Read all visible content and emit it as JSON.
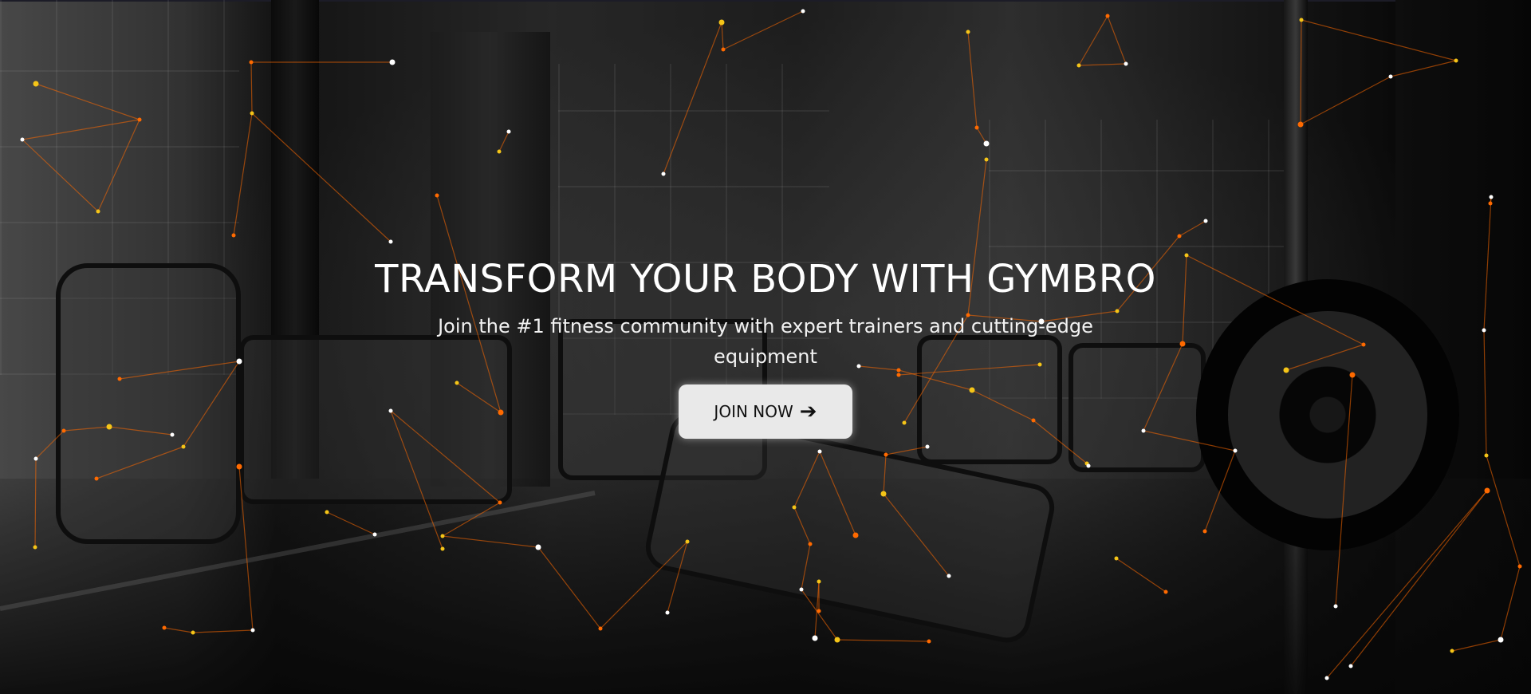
{
  "hero": {
    "headline": "TRANSFORM YOUR BODY WITH GYMBRO",
    "subheadline": "Join the #1 fitness community with expert trainers and cutting-edge equipment",
    "cta": {
      "label": "JOIN NOW",
      "icon": "arrow-right-icon",
      "icon_glyph": "➔"
    }
  },
  "colors": {
    "accent": "#ff6a00",
    "particle_dot": "#f5c518",
    "particle_white": "#ffffff",
    "cta_background": "#e9e9e9",
    "cta_text": "#111111",
    "text": "#ffffff"
  }
}
